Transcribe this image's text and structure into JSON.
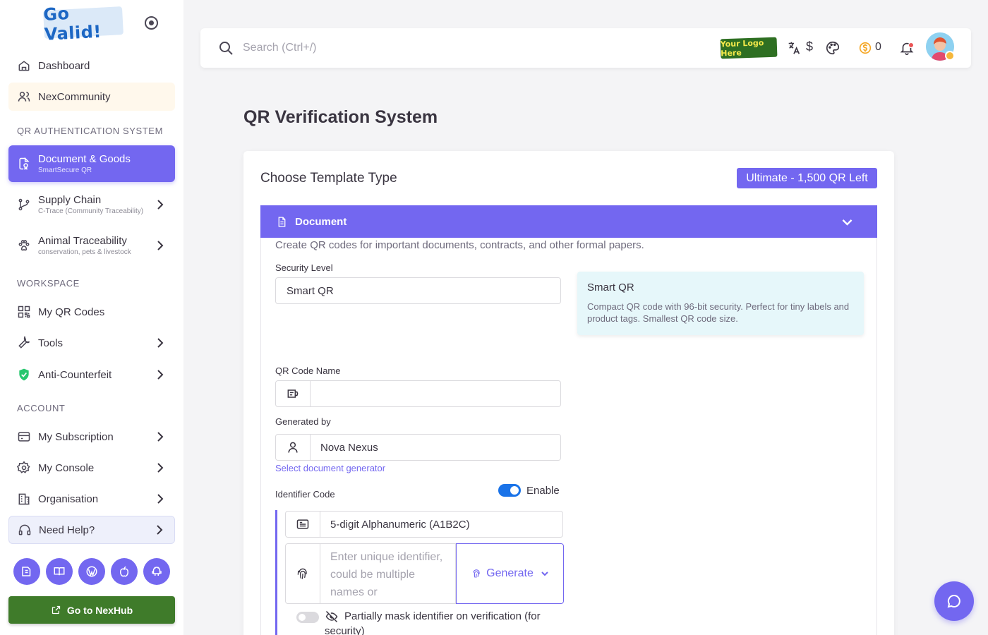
{
  "brand": {
    "logo_text": "Go Valid!"
  },
  "sidebar": {
    "items": [
      {
        "label": "Dashboard"
      },
      {
        "label": "NexCommunity"
      },
      {
        "label": "Document & Goods",
        "sub": "SmartSecure QR"
      },
      {
        "label": "Supply Chain",
        "sub": "C-Trace (Community Traceability)"
      },
      {
        "label": "Animal Traceability",
        "sub": "conservation, pets & livestock"
      },
      {
        "label": "My QR Codes"
      },
      {
        "label": "Tools"
      },
      {
        "label": "Anti-Counterfeit"
      },
      {
        "label": "My Subscription"
      },
      {
        "label": "My Console"
      },
      {
        "label": "Organisation"
      },
      {
        "label": "Need Help?"
      }
    ],
    "sections": {
      "qr_auth": "QR AUTHENTICATION SYSTEM",
      "workspace": "WORKSPACE",
      "account": "ACCOUNT"
    },
    "hub_button": "Go to NexHub"
  },
  "topbar": {
    "search_placeholder": "Search (Ctrl+/)",
    "logo_placeholder": "Your Logo Here",
    "currency_symbol": "$",
    "coin_count": "0"
  },
  "main": {
    "page_title": "QR Verification System",
    "card_title": "Choose Template Type",
    "plan_badge": "Ultimate - 1,500 QR Left",
    "accordion_title": "Document",
    "description": "Create QR codes for important documents, contracts, and other formal papers.",
    "security_level_label": "Security Level",
    "security_level_value": "Smart QR",
    "info_title": "Smart QR",
    "info_text": "Compact QR code with 96-bit security. Perfect for tiny labels and product tags. Smallest QR code size.",
    "qr_name_label": "QR Code Name",
    "qr_name_value": "",
    "generated_by_label": "Generated by",
    "generated_by_value": "Nova Nexus",
    "select_generator_link": "Select document generator",
    "identifier_label": "Identifier Code",
    "enable_label": "Enable",
    "identifier_format": "5-digit Alphanumeric (A1B2C)",
    "identifier_placeholder": "Enter unique identifier, could be multiple names or",
    "generate_button": "Generate",
    "mask_label": "Partially mask identifier on verification (for security)"
  },
  "colors": {
    "accent": "#7367f0",
    "hub_green": "#3f7b2a",
    "toggle_blue": "#1a73e8"
  }
}
